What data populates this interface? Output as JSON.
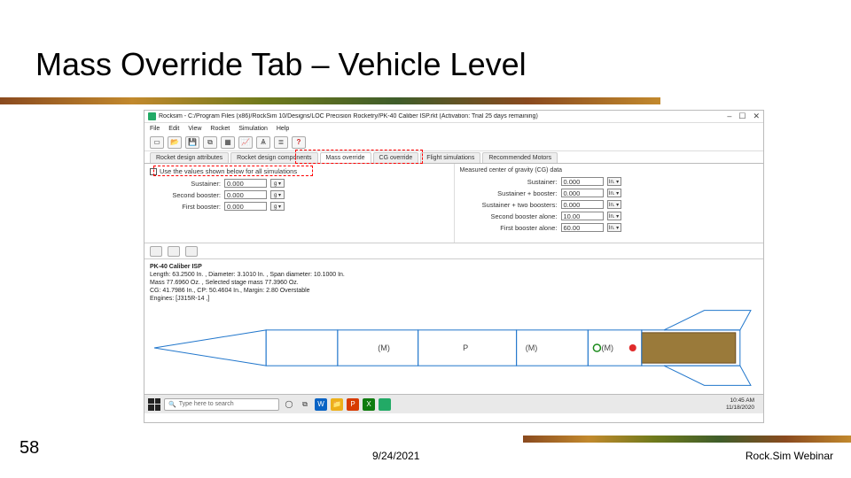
{
  "slide": {
    "title": "Mass Override Tab – Vehicle Level",
    "page_number": "58",
    "footer_date": "9/24/2021",
    "footer_label": "Rock.Sim Webinar"
  },
  "window": {
    "title": "Rocksim - C:/Program Files (x86)/RockSim 10/Designs/LOC Precision Rocketry/PK-40 Caliber ISP.rkt  (Activation: Trial 25 days remaining)",
    "controls": {
      "min": "–",
      "max": "☐",
      "close": "✕"
    }
  },
  "menu": [
    "File",
    "Edit",
    "View",
    "Rocket",
    "Simulation",
    "Help"
  ],
  "toolbar_icons": [
    "new-icon",
    "open-icon",
    "save-icon",
    "copy-icon",
    "grid-icon",
    "chart-icon",
    "tower-icon",
    "list-icon",
    "help-icon"
  ],
  "tabs": [
    "Rocket design attributes",
    "Rocket design components",
    "Mass override",
    "CG override",
    "Flight simulations",
    "Recommended Motors"
  ],
  "override": {
    "checkbox_label": "Use the values shown below for all simulations",
    "left_rows": [
      {
        "label": "Sustainer:",
        "value": "0.000",
        "unit": "g ▾"
      },
      {
        "label": "Second booster:",
        "value": "0.000",
        "unit": "g ▾"
      },
      {
        "label": "First booster:",
        "value": "0.000",
        "unit": "g ▾"
      }
    ],
    "right_header": "Measured center of gravity (CG) data",
    "right_rows": [
      {
        "label": "Sustainer:",
        "value": "0.000",
        "unit": "In. ▾"
      },
      {
        "label": "Sustainer + booster:",
        "value": "0.000",
        "unit": "In. ▾"
      },
      {
        "label": "Sustainer + two boosters:",
        "value": "0.000",
        "unit": "In. ▾"
      },
      {
        "label": "Second booster alone:",
        "value": "10.00",
        "unit": "In. ▾"
      },
      {
        "label": "First booster alone:",
        "value": "60.00",
        "unit": "In. ▾"
      }
    ]
  },
  "rocket": {
    "name": "PK-40 Caliber ISP",
    "line1": "Length: 63.2500 In. , Diameter: 3.1010 In. , Span diameter: 10.1000 In.",
    "line2": "Mass 77.6960 Oz. , Selected stage mass 77.3960 Oz.",
    "line3": "CG: 41.7986 In., CP: 50.4604 In., Margin: 2.80 Overstable",
    "line4": "Engines: [J315R-14 ,]",
    "M": "(M)",
    "P": "P"
  },
  "taskbar": {
    "search_placeholder": "Type here to search",
    "time": "10:45 AM",
    "date": "11/18/2020"
  }
}
